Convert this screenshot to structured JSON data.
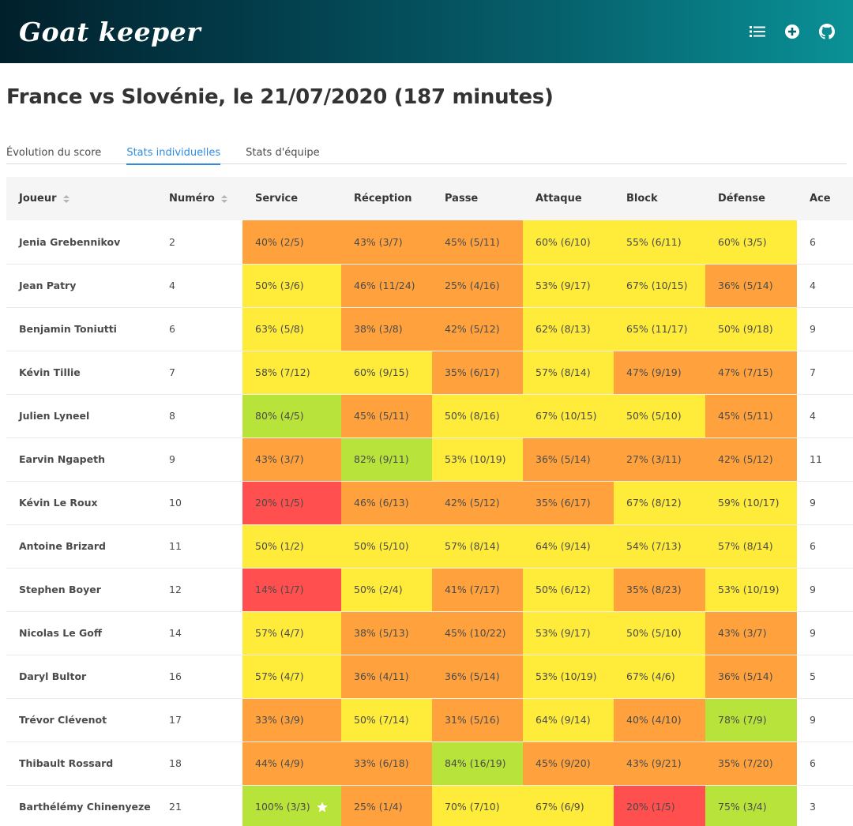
{
  "navbar": {
    "brand": "Goat keeper",
    "icons": [
      "list-icon",
      "add-circle-icon",
      "github-icon"
    ]
  },
  "page_title": "France vs Slovénie, le 21/07/2020 (187 minutes)",
  "tabs": [
    {
      "label": "Évolution du score",
      "active": false
    },
    {
      "label": "Stats individuelles",
      "active": true
    },
    {
      "label": "Stats d'équipe",
      "active": false
    }
  ],
  "colors": {
    "red": "#ff4f4f",
    "orange": "#ffa23e",
    "yellow": "#ffeb3a",
    "green": "#b7e33b"
  },
  "table": {
    "headers": {
      "player": "Joueur",
      "number": "Numéro",
      "service": "Service",
      "reception": "Réception",
      "pass": "Passe",
      "attack": "Attaque",
      "block": "Block",
      "defense": "Défense",
      "ace": "Ace"
    },
    "rows": [
      {
        "name": "Jenia Grebennikov",
        "number": "2",
        "stats": [
          {
            "t": "40% (2/5)",
            "c": "orange"
          },
          {
            "t": "43% (3/7)",
            "c": "orange"
          },
          {
            "t": "45% (5/11)",
            "c": "orange"
          },
          {
            "t": "60% (6/10)",
            "c": "yellow"
          },
          {
            "t": "55% (6/11)",
            "c": "yellow"
          },
          {
            "t": "60% (3/5)",
            "c": "yellow"
          }
        ],
        "ace": "6"
      },
      {
        "name": "Jean Patry",
        "number": "4",
        "stats": [
          {
            "t": "50% (3/6)",
            "c": "yellow"
          },
          {
            "t": "46% (11/24)",
            "c": "orange"
          },
          {
            "t": "25% (4/16)",
            "c": "orange"
          },
          {
            "t": "53% (9/17)",
            "c": "yellow"
          },
          {
            "t": "67% (10/15)",
            "c": "yellow"
          },
          {
            "t": "36% (5/14)",
            "c": "orange"
          }
        ],
        "ace": "4"
      },
      {
        "name": "Benjamin Toniutti",
        "number": "6",
        "stats": [
          {
            "t": "63% (5/8)",
            "c": "yellow"
          },
          {
            "t": "38% (3/8)",
            "c": "orange"
          },
          {
            "t": "42% (5/12)",
            "c": "orange"
          },
          {
            "t": "62% (8/13)",
            "c": "yellow"
          },
          {
            "t": "65% (11/17)",
            "c": "yellow"
          },
          {
            "t": "50% (9/18)",
            "c": "yellow"
          }
        ],
        "ace": "9"
      },
      {
        "name": "Kévin Tillie",
        "number": "7",
        "stats": [
          {
            "t": "58% (7/12)",
            "c": "yellow"
          },
          {
            "t": "60% (9/15)",
            "c": "yellow"
          },
          {
            "t": "35% (6/17)",
            "c": "orange"
          },
          {
            "t": "57% (8/14)",
            "c": "yellow"
          },
          {
            "t": "47% (9/19)",
            "c": "orange"
          },
          {
            "t": "47% (7/15)",
            "c": "orange"
          }
        ],
        "ace": "7"
      },
      {
        "name": "Julien Lyneel",
        "number": "8",
        "stats": [
          {
            "t": "80% (4/5)",
            "c": "green"
          },
          {
            "t": "45% (5/11)",
            "c": "orange"
          },
          {
            "t": "50% (8/16)",
            "c": "yellow"
          },
          {
            "t": "67% (10/15)",
            "c": "yellow"
          },
          {
            "t": "50% (5/10)",
            "c": "yellow"
          },
          {
            "t": "45% (5/11)",
            "c": "orange"
          }
        ],
        "ace": "4"
      },
      {
        "name": "Earvin Ngapeth",
        "number": "9",
        "stats": [
          {
            "t": "43% (3/7)",
            "c": "orange"
          },
          {
            "t": "82% (9/11)",
            "c": "green"
          },
          {
            "t": "53% (10/19)",
            "c": "yellow"
          },
          {
            "t": "36% (5/14)",
            "c": "orange"
          },
          {
            "t": "27% (3/11)",
            "c": "orange"
          },
          {
            "t": "42% (5/12)",
            "c": "orange"
          }
        ],
        "ace": "11"
      },
      {
        "name": "Kévin Le Roux",
        "number": "10",
        "stats": [
          {
            "t": "20% (1/5)",
            "c": "red"
          },
          {
            "t": "46% (6/13)",
            "c": "orange"
          },
          {
            "t": "42% (5/12)",
            "c": "orange"
          },
          {
            "t": "35% (6/17)",
            "c": "orange"
          },
          {
            "t": "67% (8/12)",
            "c": "yellow"
          },
          {
            "t": "59% (10/17)",
            "c": "yellow"
          }
        ],
        "ace": "9"
      },
      {
        "name": "Antoine Brizard",
        "number": "11",
        "stats": [
          {
            "t": "50% (1/2)",
            "c": "yellow"
          },
          {
            "t": "50% (5/10)",
            "c": "yellow"
          },
          {
            "t": "57% (8/14)",
            "c": "yellow"
          },
          {
            "t": "64% (9/14)",
            "c": "yellow"
          },
          {
            "t": "54% (7/13)",
            "c": "yellow"
          },
          {
            "t": "57% (8/14)",
            "c": "yellow"
          }
        ],
        "ace": "6"
      },
      {
        "name": "Stephen Boyer",
        "number": "12",
        "stats": [
          {
            "t": "14% (1/7)",
            "c": "red"
          },
          {
            "t": "50% (2/4)",
            "c": "yellow"
          },
          {
            "t": "41% (7/17)",
            "c": "orange"
          },
          {
            "t": "50% (6/12)",
            "c": "yellow"
          },
          {
            "t": "35% (8/23)",
            "c": "orange"
          },
          {
            "t": "53% (10/19)",
            "c": "yellow"
          }
        ],
        "ace": "9"
      },
      {
        "name": "Nicolas Le Goff",
        "number": "14",
        "stats": [
          {
            "t": "57% (4/7)",
            "c": "yellow"
          },
          {
            "t": "38% (5/13)",
            "c": "orange"
          },
          {
            "t": "45% (10/22)",
            "c": "orange"
          },
          {
            "t": "53% (9/17)",
            "c": "yellow"
          },
          {
            "t": "50% (5/10)",
            "c": "yellow"
          },
          {
            "t": "43% (3/7)",
            "c": "orange"
          }
        ],
        "ace": "9"
      },
      {
        "name": "Daryl Bultor",
        "number": "16",
        "stats": [
          {
            "t": "57% (4/7)",
            "c": "yellow"
          },
          {
            "t": "36% (4/11)",
            "c": "orange"
          },
          {
            "t": "36% (5/14)",
            "c": "orange"
          },
          {
            "t": "53% (10/19)",
            "c": "yellow"
          },
          {
            "t": "67% (4/6)",
            "c": "yellow"
          },
          {
            "t": "36% (5/14)",
            "c": "orange"
          }
        ],
        "ace": "5"
      },
      {
        "name": "Trévor Clévenot",
        "number": "17",
        "stats": [
          {
            "t": "33% (3/9)",
            "c": "orange"
          },
          {
            "t": "50% (7/14)",
            "c": "yellow"
          },
          {
            "t": "31% (5/16)",
            "c": "orange"
          },
          {
            "t": "64% (9/14)",
            "c": "yellow"
          },
          {
            "t": "40% (4/10)",
            "c": "orange"
          },
          {
            "t": "78% (7/9)",
            "c": "green"
          }
        ],
        "ace": "9"
      },
      {
        "name": "Thibault Rossard",
        "number": "18",
        "stats": [
          {
            "t": "44% (4/9)",
            "c": "orange"
          },
          {
            "t": "33% (6/18)",
            "c": "orange"
          },
          {
            "t": "84% (16/19)",
            "c": "green"
          },
          {
            "t": "45% (9/20)",
            "c": "orange"
          },
          {
            "t": "43% (9/21)",
            "c": "orange"
          },
          {
            "t": "35% (7/20)",
            "c": "orange"
          }
        ],
        "ace": "6"
      },
      {
        "name": "Barthélémy Chinenyeze",
        "number": "21",
        "stats": [
          {
            "t": "100% (3/3)",
            "c": "green",
            "star": true
          },
          {
            "t": "25% (1/4)",
            "c": "orange"
          },
          {
            "t": "70% (7/10)",
            "c": "yellow"
          },
          {
            "t": "67% (6/9)",
            "c": "yellow"
          },
          {
            "t": "20% (1/5)",
            "c": "red"
          },
          {
            "t": "75% (3/4)",
            "c": "green"
          }
        ],
        "ace": "3"
      }
    ]
  }
}
